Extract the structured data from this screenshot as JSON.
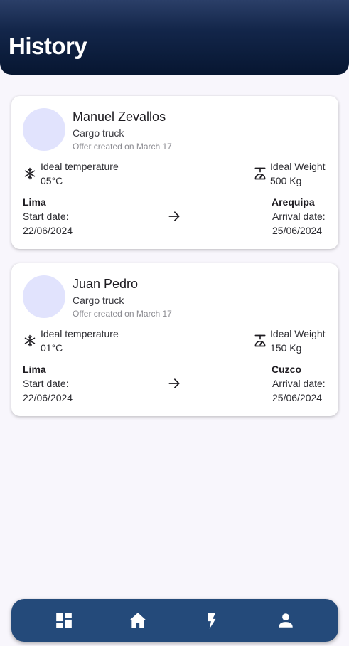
{
  "header": {
    "title": "History"
  },
  "cards": [
    {
      "name": "Manuel Zevallos",
      "vehicle": "Cargo truck",
      "offer": "Offer created on March 17",
      "temp_label": "Ideal temperature",
      "temp_value": "05°C",
      "weight_label": "Ideal Weight",
      "weight_value": "500 Kg",
      "origin": "Lima",
      "start_label": "Start date:",
      "start_date": "22/06/2024",
      "destination": "Arequipa",
      "arrival_label": "Arrival date:",
      "arrival_date": "25/06/2024"
    },
    {
      "name": "Juan Pedro",
      "vehicle": "Cargo truck",
      "offer": "Offer created on March 17",
      "temp_label": "Ideal temperature",
      "temp_value": "01°C",
      "weight_label": "Ideal Weight",
      "weight_value": "150 Kg",
      "origin": "Lima",
      "start_label": "Start date:",
      "start_date": "22/06/2024",
      "destination": "Cuzco",
      "arrival_label": "Arrival date:",
      "arrival_date": "25/06/2024"
    }
  ],
  "navbar": {
    "items": [
      {
        "icon": "dashboard-icon"
      },
      {
        "icon": "home-icon"
      },
      {
        "icon": "flash-icon"
      },
      {
        "icon": "person-icon"
      }
    ]
  },
  "colors": {
    "header_gradient_top": "#2b3f68",
    "header_gradient_bottom": "#071631",
    "navbar": "#244a7a",
    "avatar": "#e1e3fd",
    "background": "#f8f6fc"
  }
}
